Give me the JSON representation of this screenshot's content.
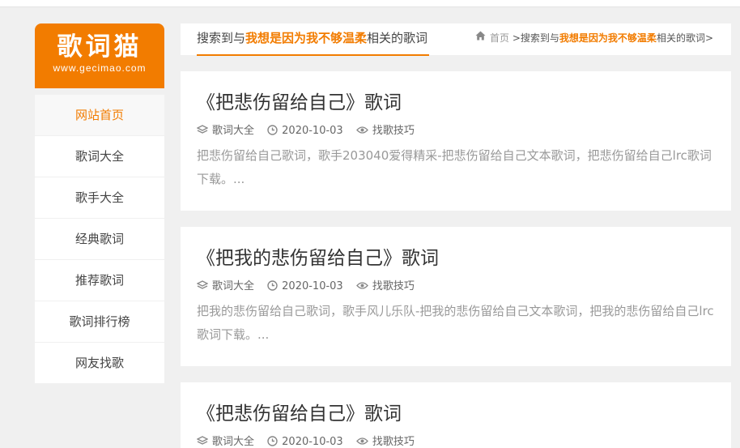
{
  "logo": {
    "title": "歌词猫",
    "url": "www.gecimao.com"
  },
  "nav": [
    {
      "label": "网站首页",
      "active": true
    },
    {
      "label": "歌词大全"
    },
    {
      "label": "歌手大全"
    },
    {
      "label": "经典歌词"
    },
    {
      "label": "推荐歌词"
    },
    {
      "label": "歌词排行榜"
    },
    {
      "label": "网友找歌"
    }
  ],
  "header": {
    "prefix": "搜索到与",
    "keyword": "我想是因为我不够温柔",
    "suffix": "相关的歌词"
  },
  "breadcrumb": {
    "home": "首页",
    "sep1": " >",
    "prefix": "搜索到与",
    "keyword": "我想是因为我不够温柔",
    "suffix": "相关的歌词>"
  },
  "posts": [
    {
      "title": "《把悲伤留给自己》歌词",
      "category": "歌词大全",
      "date": "2020-10-03",
      "tag": "找歌技巧",
      "excerpt": "把悲伤留给自己歌词，歌手203040爱得精采-把悲伤留给自己文本歌词，把悲伤留给自己lrc歌词下载。..."
    },
    {
      "title": "《把我的悲伤留给自己》歌词",
      "category": "歌词大全",
      "date": "2020-10-03",
      "tag": "找歌技巧",
      "excerpt": "把我的悲伤留给自己歌词，歌手风儿乐队-把我的悲伤留给自己文本歌词，把我的悲伤留给自己lrc歌词下载。..."
    },
    {
      "title": "《把悲伤留给自己》歌词",
      "category": "歌词大全",
      "date": "2020-10-03",
      "tag": "找歌技巧",
      "excerpt": ""
    }
  ],
  "colors": {
    "accent": "#f27c00",
    "background": "#f0f0f0"
  },
  "icons": {
    "category": "layers-icon",
    "date": "clock-icon",
    "tag": "eye-icon",
    "home": "home-icon"
  }
}
